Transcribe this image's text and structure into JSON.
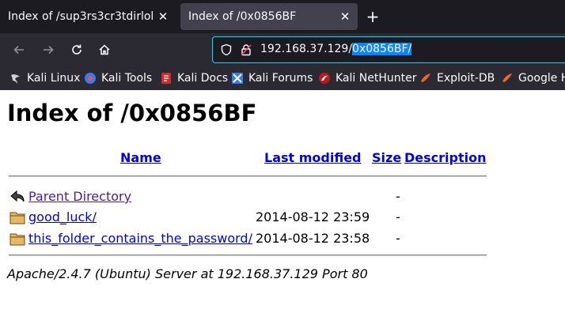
{
  "tabs": [
    {
      "title": "Index of /sup3rs3cr3tdirlol",
      "close": "✕"
    },
    {
      "title": "Index of /0x0856BF",
      "close": "✕"
    }
  ],
  "new_tab": "+",
  "url": {
    "prefix": "192.168.37.129/",
    "selected": "0x0856BF/"
  },
  "bookmarks": [
    {
      "label": "Kali Linux",
      "icon": "kali-dragon-icon"
    },
    {
      "label": "Kali Tools",
      "icon": "kali-tools-icon"
    },
    {
      "label": "Kali Docs",
      "icon": "kali-docs-icon"
    },
    {
      "label": "Kali Forums",
      "icon": "kali-forums-icon"
    },
    {
      "label": "Kali NetHunter",
      "icon": "nethunter-icon"
    },
    {
      "label": "Exploit-DB",
      "icon": "exploit-db-icon"
    },
    {
      "label": "Google Hacking DB",
      "icon": "ghdb-icon"
    }
  ],
  "page": {
    "title": "Index of /0x0856BF",
    "columns": {
      "name": "Name",
      "modified": "Last modified",
      "size": "Size",
      "description": "Description"
    },
    "rows": [
      {
        "name": "Parent Directory",
        "modified": "",
        "size": "-",
        "icon": "back-arrow-icon"
      },
      {
        "name": "good_luck/",
        "modified": "2014-08-12 23:59",
        "size": "-",
        "icon": "folder-icon"
      },
      {
        "name": "this_folder_contains_the_password/",
        "modified": "2014-08-12 23:58",
        "size": "-",
        "icon": "folder-icon"
      }
    ],
    "address": "Apache/2.4.7 (Ubuntu) Server at 192.168.37.129 Port 80"
  },
  "colors": {
    "accent": "#00ddff",
    "selection": "#0a84ff",
    "link": "#0000ee",
    "visited": "#551a8b"
  }
}
